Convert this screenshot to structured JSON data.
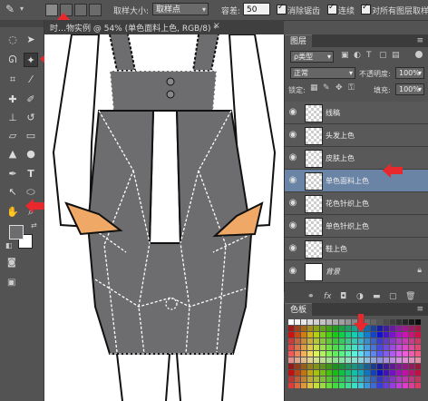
{
  "options_bar": {
    "sample_size_label": "取样大小:",
    "sample_size_value": "取样点",
    "tolerance_label": "容差:",
    "tolerance_value": "50",
    "anti_alias_label": "消除锯齿",
    "contiguous_label": "连续",
    "all_layers_label": "对所有图层取样"
  },
  "document": {
    "tab_title": "时…物实例 @ 54% (单色面料上色, RGB/8) *",
    "close_glyph": "×"
  },
  "layers_panel": {
    "tab_label": "图层",
    "filter_label": "ρ类型",
    "blend_mode": "正常",
    "opacity_label": "不透明度:",
    "opacity_value": "100%",
    "lock_label": "锁定:",
    "fill_label": "填充:",
    "fill_value": "100%",
    "layers": [
      {
        "name": "线稿",
        "selected": false
      },
      {
        "name": "头发上色",
        "selected": false
      },
      {
        "name": "皮肤上色",
        "selected": false
      },
      {
        "name": "单色面料上色",
        "selected": true
      },
      {
        "name": "花色针织上色",
        "selected": false
      },
      {
        "name": "单色针织上色",
        "selected": false
      },
      {
        "name": "鞋上色",
        "selected": false
      },
      {
        "name": "背景",
        "selected": false
      }
    ],
    "footer_icons": [
      "link-icon",
      "fx-icon",
      "mask-icon",
      "adjustment-icon",
      "group-icon",
      "new-layer-icon",
      "trash-icon"
    ]
  },
  "swatches_panel": {
    "tab_label": "色板"
  },
  "colors": {
    "accent_arrow": "#e8282d",
    "fabric_gray": "#6d6d70",
    "skin": "#f0a866",
    "selected_layer": "#6a84a5"
  }
}
